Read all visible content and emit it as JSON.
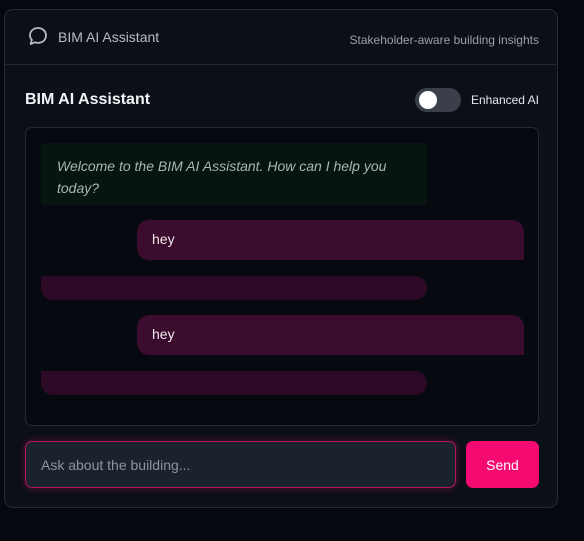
{
  "header": {
    "title": "BIM AI Assistant",
    "subtitle": "Stakeholder-aware building insights",
    "icon": "chat-bubble-icon"
  },
  "main": {
    "title": "BIM AI Assistant",
    "toggle": {
      "label": "Enhanced AI",
      "on": false
    }
  },
  "chat": {
    "messages": [
      {
        "role": "assistant",
        "text": "Welcome to the BIM AI Assistant. How can I help you today?"
      },
      {
        "role": "user",
        "text": "hey"
      },
      {
        "role": "assistant",
        "text": ""
      },
      {
        "role": "user",
        "text": "hey"
      },
      {
        "role": "assistant",
        "text": ""
      }
    ]
  },
  "composer": {
    "placeholder": "Ask about the building...",
    "value": "",
    "send_label": "Send"
  },
  "colors": {
    "accent": "#f50a72",
    "user_bubble": "#3b0c2d",
    "assistant_bubble": "#2c0a25",
    "welcome_bubble": "#071510",
    "background": "#05080f"
  }
}
